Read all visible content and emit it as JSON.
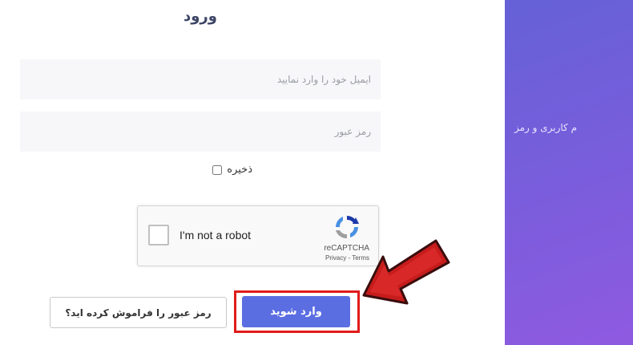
{
  "login": {
    "title": "ورود",
    "email_placeholder": "ایمیل خود را وارد نمایید",
    "password_placeholder": "رمز عبور",
    "remember_label": "ذخیره",
    "submit_label": "وارد شوید",
    "forgot_label": "رمز عبور را فراموش کرده اید؟"
  },
  "captcha": {
    "label": "I'm not a robot",
    "brand": "reCAPTCHA",
    "links": "Privacy - Terms"
  },
  "side_panel": {
    "text": "م کاربری و رمز"
  },
  "colors": {
    "accent": "#5b6ee1",
    "highlight": "#e01b1b",
    "panel_start": "#6561d6",
    "panel_end": "#8f5ae0"
  }
}
